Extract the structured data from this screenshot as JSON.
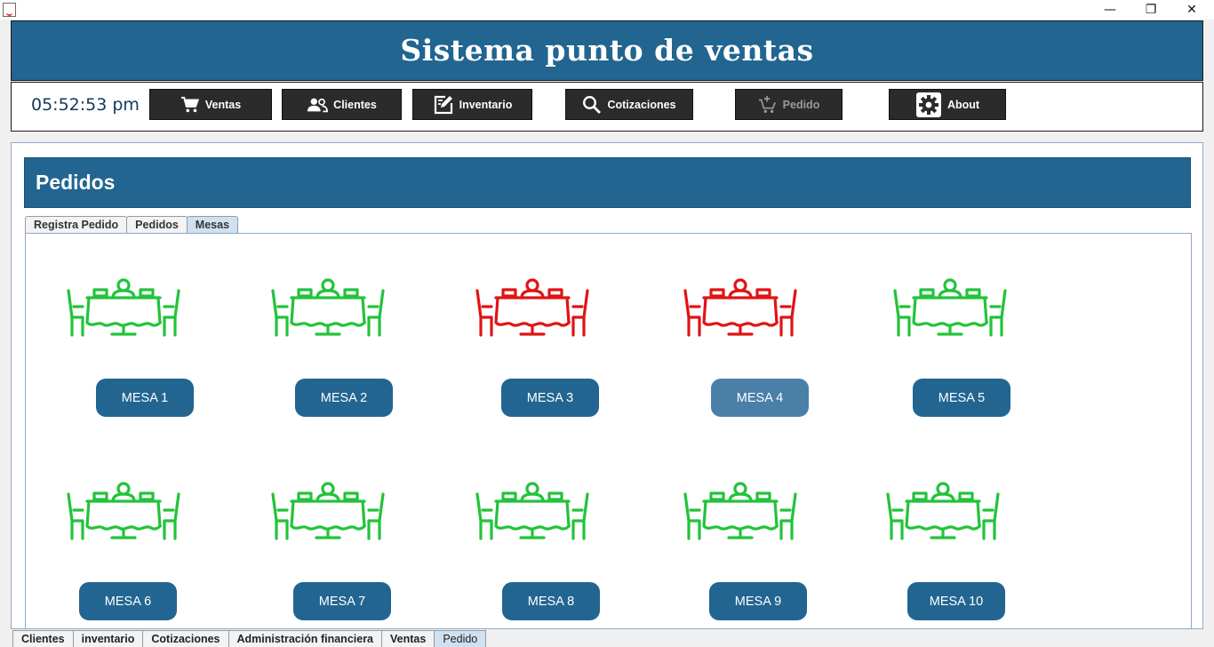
{
  "window": {
    "minimize_glyph": "—",
    "maximize_glyph": "❐",
    "close_glyph": "✕"
  },
  "header": {
    "title": "Sistema punto de ventas"
  },
  "toolbar": {
    "clock": "05:52:53 pm",
    "buttons": [
      {
        "label": "Ventas",
        "icon": "cart-icon"
      },
      {
        "label": "Clientes",
        "icon": "users-icon"
      },
      {
        "label": "Inventario",
        "icon": "edit-note-icon"
      },
      {
        "label": "Cotizaciones",
        "icon": "search-icon"
      },
      {
        "label": "Pedido",
        "icon": "add-cart-icon",
        "disabled": true
      },
      {
        "label": "About",
        "icon": "gear-icon"
      }
    ]
  },
  "main": {
    "section_title": "Pedidos",
    "tabs": [
      {
        "label": "Registra Pedido"
      },
      {
        "label": "Pedidos"
      },
      {
        "label": "Mesas",
        "active": true
      }
    ],
    "colors": {
      "free": "#22c33a",
      "occupied": "#e01414",
      "accent": "#226590"
    },
    "mesas": [
      {
        "label": "MESA 1",
        "status": "free"
      },
      {
        "label": "MESA 2",
        "status": "free"
      },
      {
        "label": "MESA 3",
        "status": "occupied"
      },
      {
        "label": "MESA 4",
        "status": "occupied",
        "hover": true
      },
      {
        "label": "MESA 5",
        "status": "free"
      },
      {
        "label": "MESA 6",
        "status": "free"
      },
      {
        "label": "MESA 7",
        "status": "free"
      },
      {
        "label": "MESA 8",
        "status": "free"
      },
      {
        "label": "MESA 9",
        "status": "free"
      },
      {
        "label": "MESA 10",
        "status": "free"
      }
    ]
  },
  "bottom_tabs": [
    {
      "label": "Clientes"
    },
    {
      "label": "inventario"
    },
    {
      "label": "Cotizaciones"
    },
    {
      "label": "Administración financiera"
    },
    {
      "label": "Ventas"
    },
    {
      "label": "Pedido",
      "active": true
    }
  ]
}
